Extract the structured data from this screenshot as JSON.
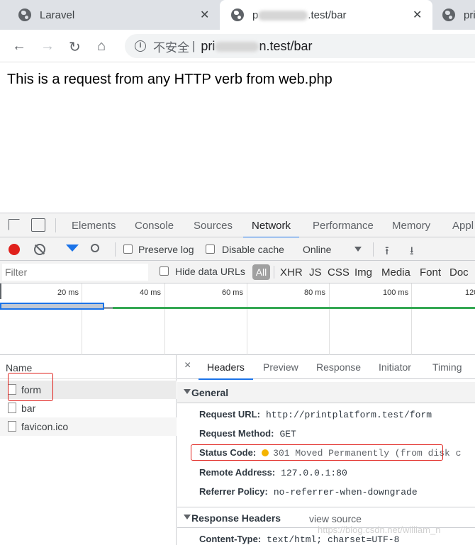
{
  "browser": {
    "tabs": [
      {
        "title": "Laravel",
        "active": false
      },
      {
        "title_prefix": "p",
        "title_suffix": ".test/bar",
        "active": true
      },
      {
        "title": "pri",
        "active": false
      }
    ],
    "address": {
      "security_label": "不安全",
      "separator": "|",
      "url_prefix": "pri",
      "url_suffix": "n.test/bar"
    }
  },
  "page": {
    "message": "This is a request from any HTTP verb from web.php"
  },
  "devtools": {
    "panels": [
      "Elements",
      "Console",
      "Sources",
      "Network",
      "Performance",
      "Memory",
      "Appl"
    ],
    "active_panel": "Network",
    "controls": {
      "preserve_log": "Preserve log",
      "disable_cache": "Disable cache",
      "throttling": "Online"
    },
    "filter": {
      "placeholder": "Filter",
      "hide_data_urls": "Hide data URLs",
      "types": [
        "All",
        "XHR",
        "JS",
        "CSS",
        "Img",
        "Media",
        "Font",
        "Doc"
      ]
    },
    "timeline_ticks": [
      "20 ms",
      "40 ms",
      "60 ms",
      "80 ms",
      "100 ms",
      "120"
    ],
    "requests": {
      "header": "Name",
      "items": [
        "form",
        "bar",
        "favicon.ico"
      ]
    },
    "detail_tabs": [
      "Headers",
      "Preview",
      "Response",
      "Initiator",
      "Timing"
    ],
    "close_symbol": "×",
    "general": {
      "title": "General",
      "request_url_label": "Request URL:",
      "request_url": "http://printplatform.test/form",
      "request_method_label": "Request Method:",
      "request_method": "GET",
      "status_code_label": "Status Code:",
      "status_code": "301 Moved Permanently (from disk c",
      "remote_address_label": "Remote Address:",
      "remote_address": "127.0.0.1:80",
      "referrer_policy_label": "Referrer Policy:",
      "referrer_policy": "no-referrer-when-downgrade"
    },
    "response_headers": {
      "title": "Response Headers",
      "view_source": "view source",
      "content_type_label": "Content-Type:",
      "content_type": "text/html; charset=UTF-8"
    }
  },
  "watermark": "https://blog.csdn.net/william_n",
  "colors": {
    "accent": "#1a73e8",
    "record": "#e0201b",
    "status_dot": "#f4b400",
    "highlight_box": "#e0201b"
  }
}
